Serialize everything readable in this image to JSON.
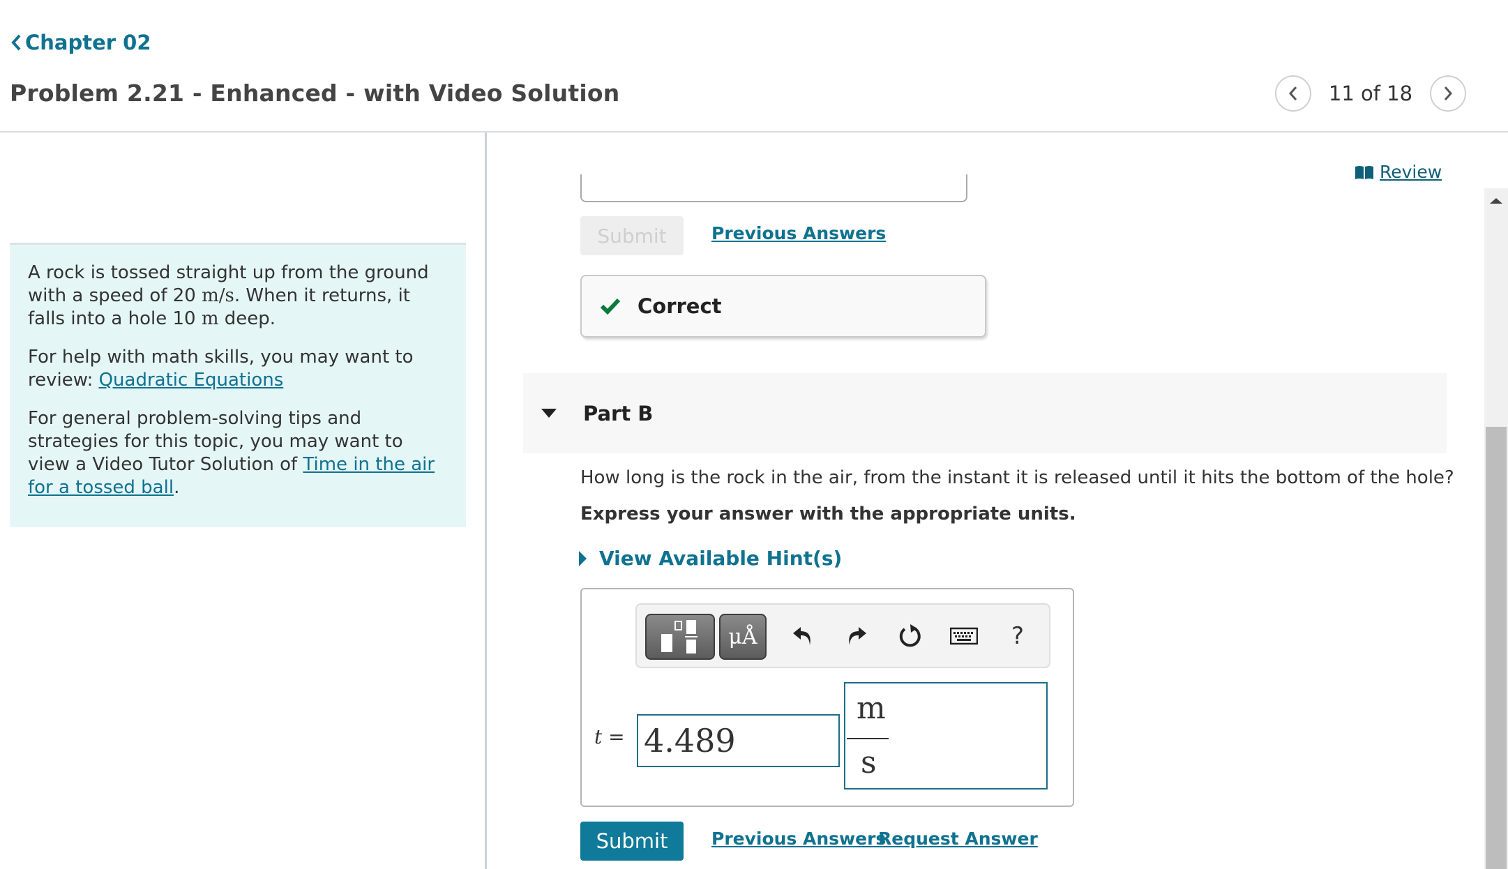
{
  "header": {
    "back_link": "Chapter 02",
    "title": "Problem 2.21 - Enhanced - with Video Solution",
    "pager": {
      "current": 11,
      "total": 18,
      "label": "11 of 18"
    }
  },
  "review_link": "Review",
  "left_panel": {
    "problem_pre": "A rock is tossed straight up from the ground with a speed of 20 ",
    "speed_unit": "m/s",
    "problem_mid": ". When it returns, it falls into a hole 10 ",
    "depth_unit": "m",
    "problem_post": " deep.",
    "math_help_pre": "For help with math skills, you may want to review: ",
    "math_help_link": "Quadratic Equations",
    "tips_pre": "For general problem-solving tips and strategies for this topic, you may want to view a Video Tutor Solution of ",
    "tips_link": "Time in the air for a tossed ball",
    "tips_post": "."
  },
  "part_a": {
    "submit_label": "Submit",
    "previous_answers": "Previous Answers",
    "feedback": "Correct"
  },
  "part_b": {
    "title": "Part B",
    "question": "How long is the rock in the air, from the instant it is released until it hits the bottom of the hole?",
    "instruction": "Express your answer with the appropriate units.",
    "hints_label": "View Available Hint(s)",
    "toolbar": {
      "templates_icon": "fraction-template-icon",
      "units_label": "μÅ",
      "undo_icon": "undo-icon",
      "redo_icon": "redo-icon",
      "reset_icon": "reset-icon",
      "keyboard_icon": "keyboard-icon",
      "help_label": "?"
    },
    "variable": "t",
    "equals": "=",
    "value": "4.489",
    "units_numerator": "m",
    "units_denominator": "s",
    "submit_label": "Submit",
    "previous_answers": "Previous Answers",
    "request_answer": "Request Answer"
  },
  "colors": {
    "accent": "#0f7290",
    "submit_bg": "#0f7a99",
    "correct_check": "#0a7a3b",
    "panel_bg": "#e5f6f7"
  }
}
